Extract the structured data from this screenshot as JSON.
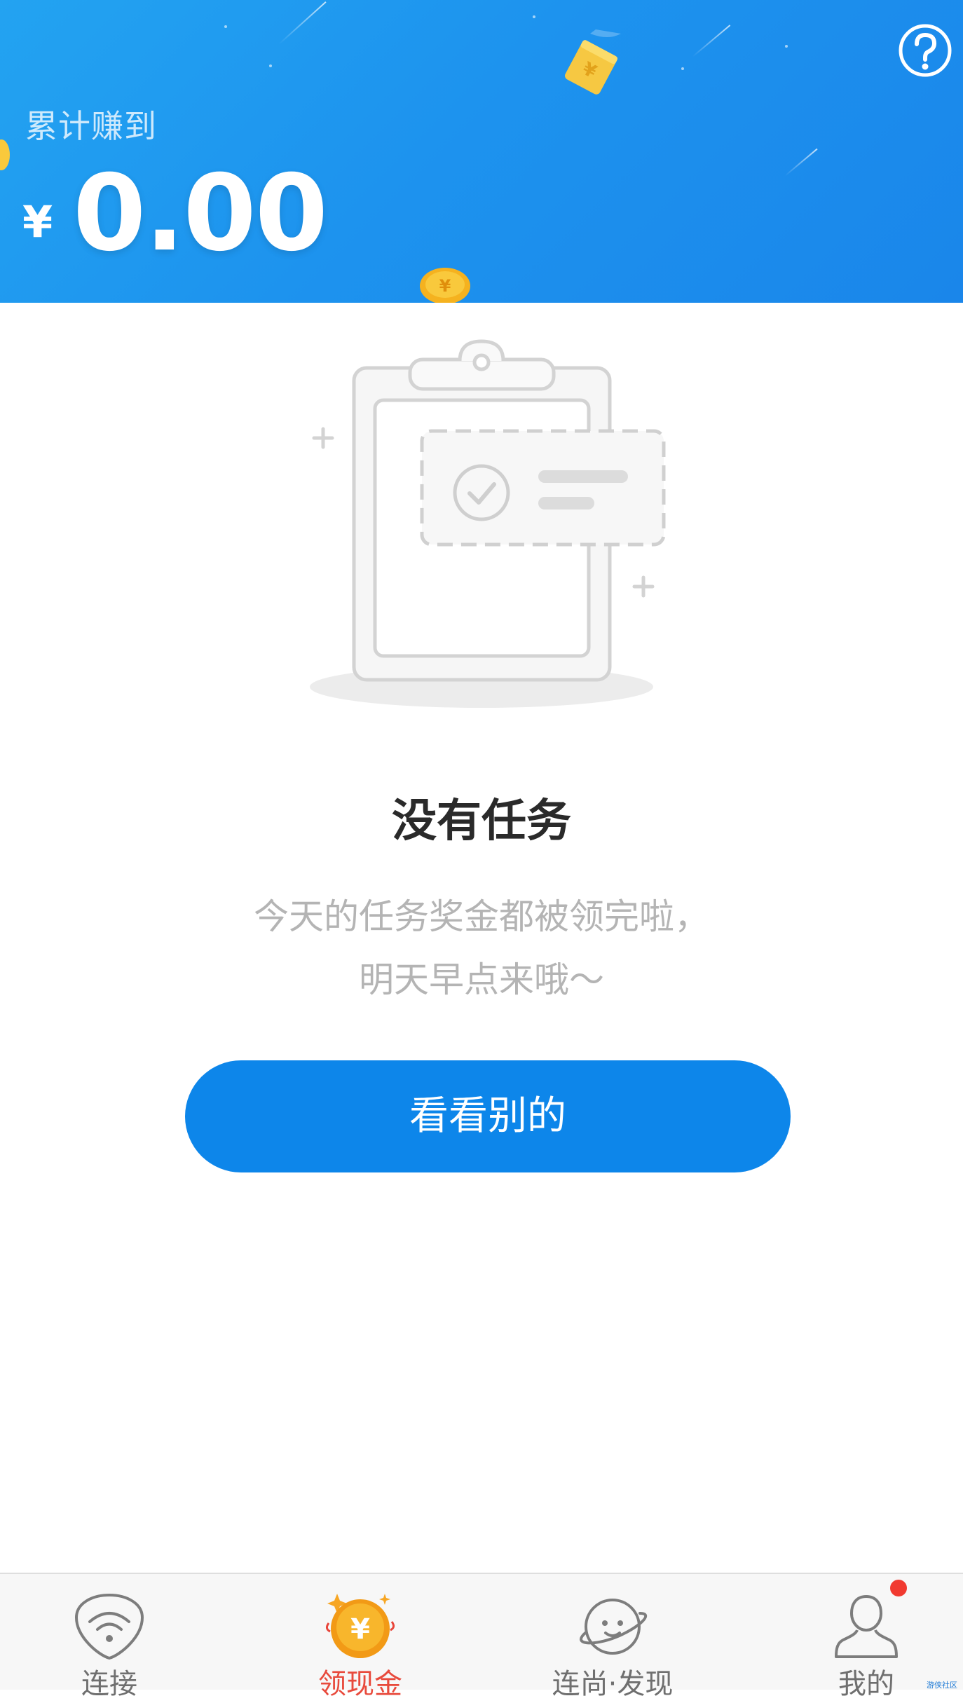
{
  "header": {
    "earned_label": "累计赚到",
    "currency_symbol": "¥",
    "earned_amount": "0.00"
  },
  "empty_state": {
    "title": "没有任务",
    "desc_line1": "今天的任务奖金都被领完啦，",
    "desc_line2": "明天早点来哦～",
    "button_label": "看看别的"
  },
  "bottom_nav": {
    "items": [
      {
        "label": "连接",
        "icon": "wifi-icon",
        "active": false
      },
      {
        "label": "领现金",
        "icon": "yen-coin-icon",
        "active": true
      },
      {
        "label": "连尚·发现",
        "icon": "planet-icon",
        "active": false
      },
      {
        "label": "我的",
        "icon": "user-icon",
        "active": false,
        "notification": true
      }
    ]
  },
  "watermark": "游侠社区",
  "colors": {
    "header_blue": "#1d93ee",
    "button_blue": "#0d86ea",
    "active_tab_red": "#e84a3c",
    "notification_red": "#f13a30"
  }
}
